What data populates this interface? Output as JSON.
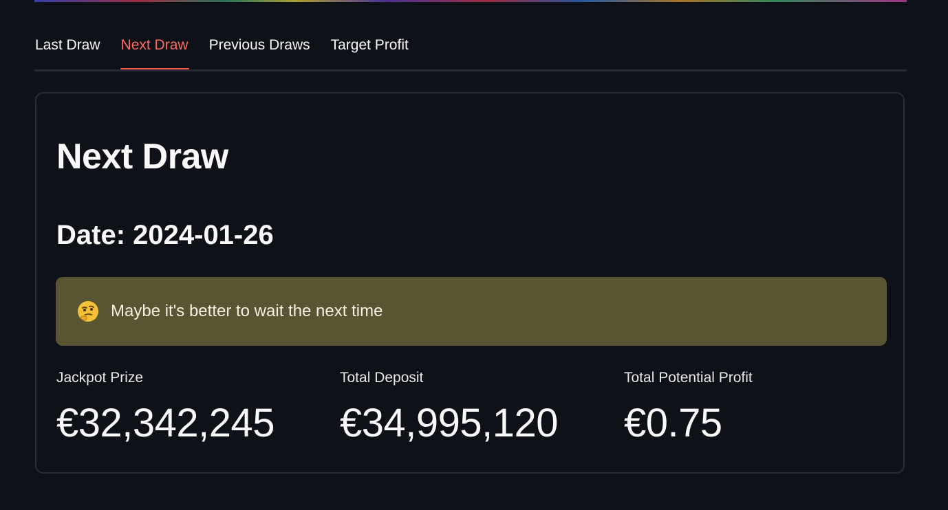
{
  "tabs": [
    {
      "label": "Last Draw",
      "active": false
    },
    {
      "label": "Next Draw",
      "active": true
    },
    {
      "label": "Previous Draws",
      "active": false
    },
    {
      "label": "Target Profit",
      "active": false
    }
  ],
  "colors": {
    "background": "#0e1117",
    "accent": "#ff5a4f",
    "alert_background": "#595432"
  },
  "card": {
    "title": "Next Draw",
    "date_line": "Date: 2024-01-26",
    "alert": {
      "icon": "thinking-face-icon",
      "text": "Maybe it's better to wait the next time"
    },
    "metrics": [
      {
        "label": "Jackpot Prize",
        "value": "€32,342,245"
      },
      {
        "label": "Total Deposit",
        "value": "€34,995,120"
      },
      {
        "label": "Total Potential Profit",
        "value": "€0.75"
      }
    ]
  }
}
